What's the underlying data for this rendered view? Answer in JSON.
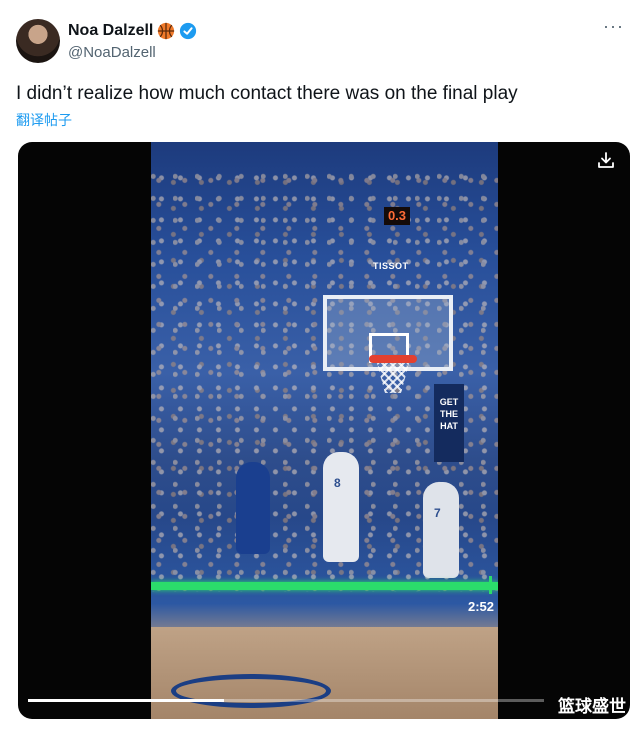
{
  "author": {
    "display_name": "Noa Dalzell",
    "handle": "@NoaDalzell"
  },
  "post": {
    "text": "I didn’t realize how much contact there was on the final play",
    "translate_label": "翻译帖子"
  },
  "video": {
    "scoreboard": "0.3",
    "sponsor": "TISSOT",
    "jersey_left": "8",
    "jersey_right": "7",
    "sign_text": "GET THE HAT",
    "timestamp": "2:52",
    "progress": 0.38,
    "watermark": "篮球盛世"
  },
  "colors": {
    "accent": "#1d9bf0",
    "progress_line": "#2bdc6b"
  },
  "icons": {
    "more": "more-icon",
    "verified": "verified-icon",
    "download": "download-icon",
    "basketball": "basketball-icon"
  }
}
